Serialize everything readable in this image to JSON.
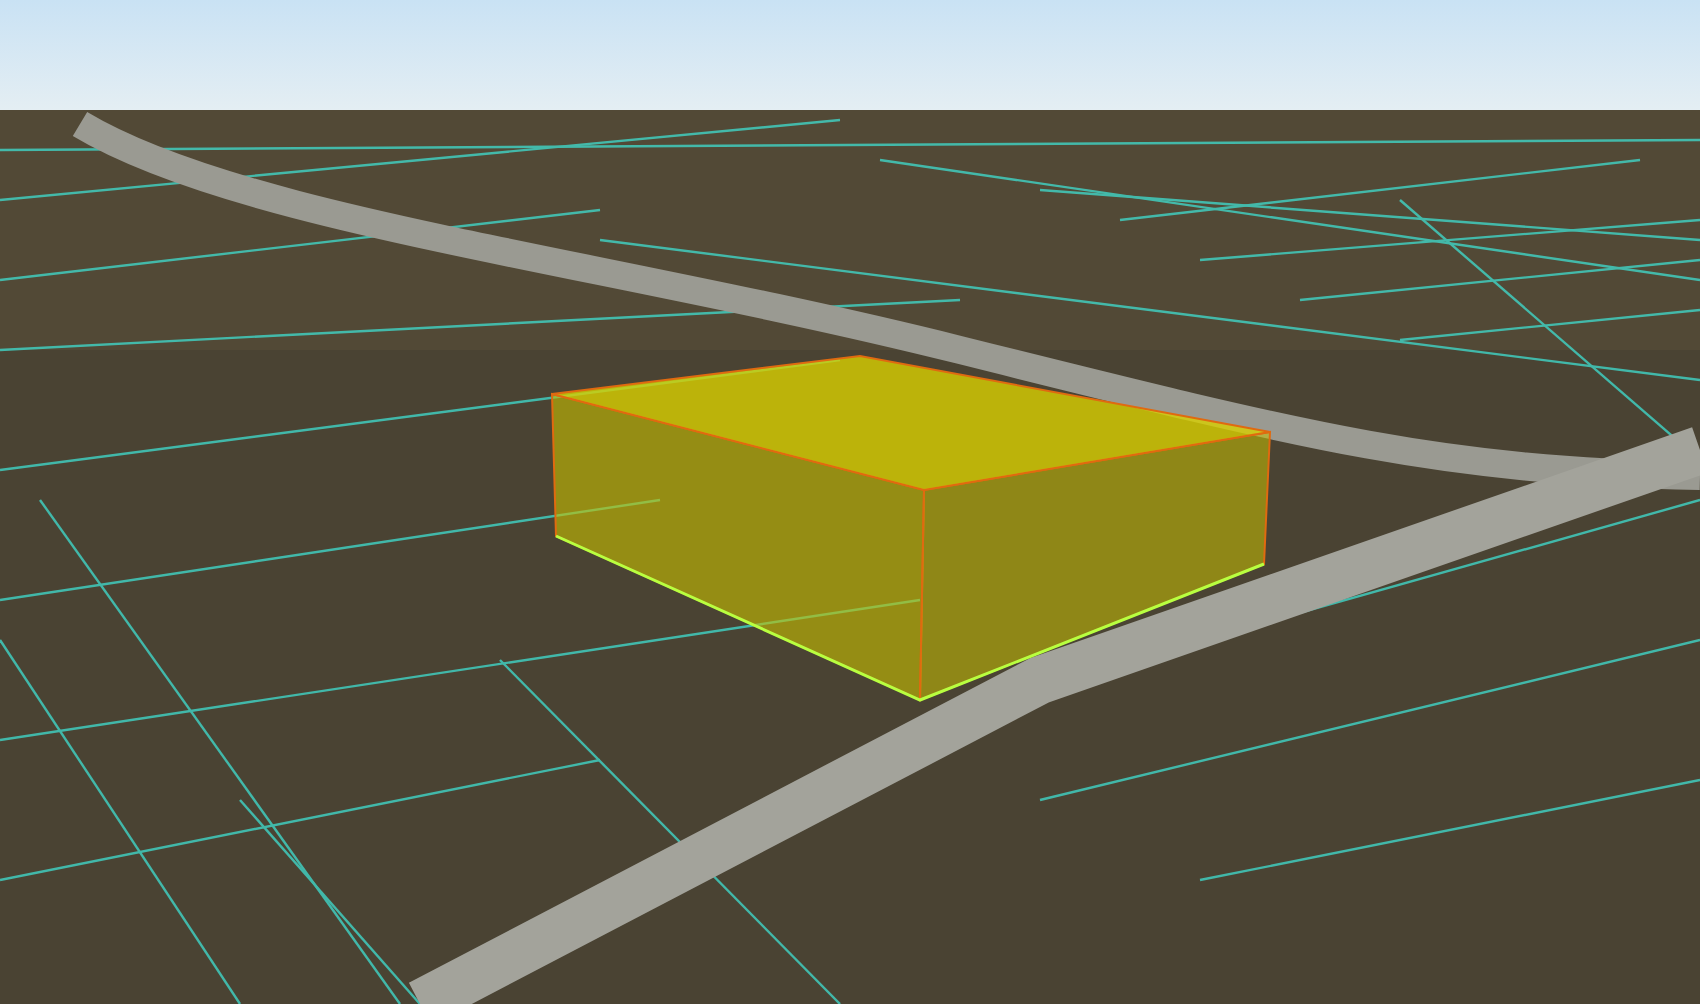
{
  "scene": {
    "kind": "aerial-3d"
  }
}
